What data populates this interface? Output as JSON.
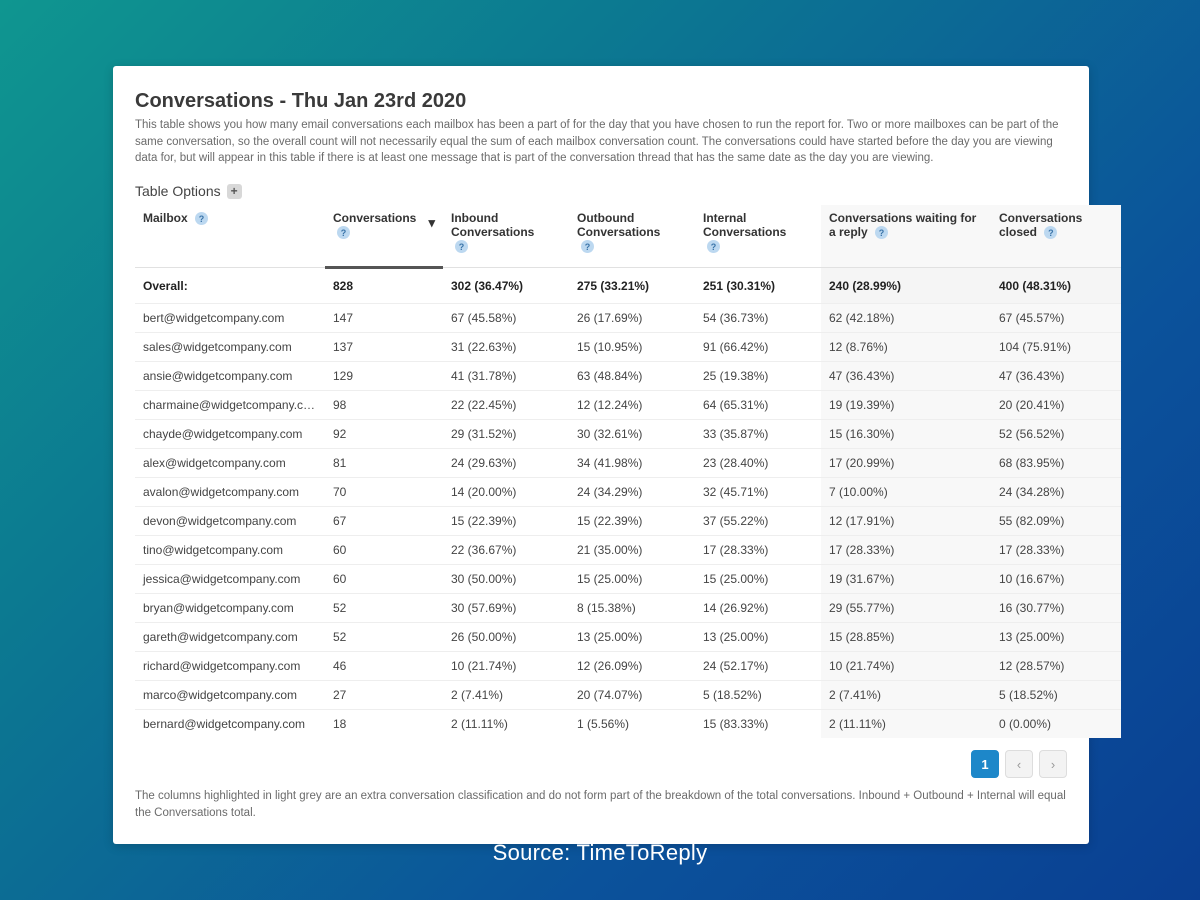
{
  "title": "Conversations - Thu Jan 23rd 2020",
  "description": "This table shows you how many email conversations each mailbox has been a part of for the day that you have chosen to run the report for. Two or more mailboxes can be part of the same conversation, so the overall count will not necessarily equal the sum of each mailbox conversation count. The conversations could have started before the day you are viewing data for, but will appear in this table if there is at least one message that is part of the conversation thread that has the same date as the day you are viewing.",
  "table_options_label": "Table Options",
  "columns": {
    "mailbox": "Mailbox",
    "conversations": "Conversations",
    "inbound": "Inbound Conversations",
    "outbound": "Outbound Conversations",
    "internal": "Internal Conversations",
    "waiting": "Conversations waiting for a reply",
    "closed": "Conversations closed"
  },
  "overall_label": "Overall:",
  "overall": {
    "conversations": "828",
    "inbound": "302 (36.47%)",
    "outbound": "275 (33.21%)",
    "internal": "251 (30.31%)",
    "waiting": "240 (28.99%)",
    "closed": "400 (48.31%)"
  },
  "rows": [
    {
      "mailbox": "bert@widgetcompany.com",
      "conversations": "147",
      "inbound": "67 (45.58%)",
      "outbound": "26 (17.69%)",
      "internal": "54 (36.73%)",
      "waiting": "62 (42.18%)",
      "closed": "67 (45.57%)"
    },
    {
      "mailbox": "sales@widgetcompany.com",
      "conversations": "137",
      "inbound": "31 (22.63%)",
      "outbound": "15 (10.95%)",
      "internal": "91 (66.42%)",
      "waiting": "12 (8.76%)",
      "closed": "104 (75.91%)"
    },
    {
      "mailbox": "ansie@widgetcompany.com",
      "conversations": "129",
      "inbound": "41 (31.78%)",
      "outbound": "63 (48.84%)",
      "internal": "25 (19.38%)",
      "waiting": "47 (36.43%)",
      "closed": "47 (36.43%)"
    },
    {
      "mailbox": "charmaine@widgetcompany.com",
      "conversations": "98",
      "inbound": "22 (22.45%)",
      "outbound": "12 (12.24%)",
      "internal": "64 (65.31%)",
      "waiting": "19 (19.39%)",
      "closed": "20 (20.41%)"
    },
    {
      "mailbox": "chayde@widgetcompany.com",
      "conversations": "92",
      "inbound": "29 (31.52%)",
      "outbound": "30 (32.61%)",
      "internal": "33 (35.87%)",
      "waiting": "15 (16.30%)",
      "closed": "52 (56.52%)"
    },
    {
      "mailbox": "alex@widgetcompany.com",
      "conversations": "81",
      "inbound": "24 (29.63%)",
      "outbound": "34 (41.98%)",
      "internal": "23 (28.40%)",
      "waiting": "17 (20.99%)",
      "closed": "68 (83.95%)"
    },
    {
      "mailbox": "avalon@widgetcompany.com",
      "conversations": "70",
      "inbound": "14 (20.00%)",
      "outbound": "24 (34.29%)",
      "internal": "32 (45.71%)",
      "waiting": "7 (10.00%)",
      "closed": "24 (34.28%)"
    },
    {
      "mailbox": "devon@widgetcompany.com",
      "conversations": "67",
      "inbound": "15 (22.39%)",
      "outbound": "15 (22.39%)",
      "internal": "37 (55.22%)",
      "waiting": "12 (17.91%)",
      "closed": "55 (82.09%)"
    },
    {
      "mailbox": "tino@widgetcompany.com",
      "conversations": "60",
      "inbound": "22 (36.67%)",
      "outbound": "21 (35.00%)",
      "internal": "17 (28.33%)",
      "waiting": "17 (28.33%)",
      "closed": "17 (28.33%)"
    },
    {
      "mailbox": "jessica@widgetcompany.com",
      "conversations": "60",
      "inbound": "30 (50.00%)",
      "outbound": "15 (25.00%)",
      "internal": "15 (25.00%)",
      "waiting": "19 (31.67%)",
      "closed": "10 (16.67%)"
    },
    {
      "mailbox": "bryan@widgetcompany.com",
      "conversations": "52",
      "inbound": "30 (57.69%)",
      "outbound": "8 (15.38%)",
      "internal": "14 (26.92%)",
      "waiting": "29 (55.77%)",
      "closed": "16 (30.77%)"
    },
    {
      "mailbox": "gareth@widgetcompany.com",
      "conversations": "52",
      "inbound": "26 (50.00%)",
      "outbound": "13 (25.00%)",
      "internal": "13 (25.00%)",
      "waiting": "15 (28.85%)",
      "closed": "13 (25.00%)"
    },
    {
      "mailbox": "richard@widgetcompany.com",
      "conversations": "46",
      "inbound": "10 (21.74%)",
      "outbound": "12 (26.09%)",
      "internal": "24 (52.17%)",
      "waiting": "10 (21.74%)",
      "closed": "12 (28.57%)"
    },
    {
      "mailbox": "marco@widgetcompany.com",
      "conversations": "27",
      "inbound": "2 (7.41%)",
      "outbound": "20 (74.07%)",
      "internal": "5 (18.52%)",
      "waiting": "2 (7.41%)",
      "closed": "5 (18.52%)"
    },
    {
      "mailbox": "bernard@widgetcompany.com",
      "conversations": "18",
      "inbound": "2 (11.11%)",
      "outbound": "1 (5.56%)",
      "internal": "15 (83.33%)",
      "waiting": "2 (11.11%)",
      "closed": "0 (0.00%)"
    }
  ],
  "pager": {
    "current": "1"
  },
  "footer_note": "The columns highlighted in light grey are an extra conversation classification and do not form part of the breakdown of the total conversations. Inbound + Outbound + Internal will equal the Conversations total.",
  "source_caption": "Source: TimeToReply"
}
